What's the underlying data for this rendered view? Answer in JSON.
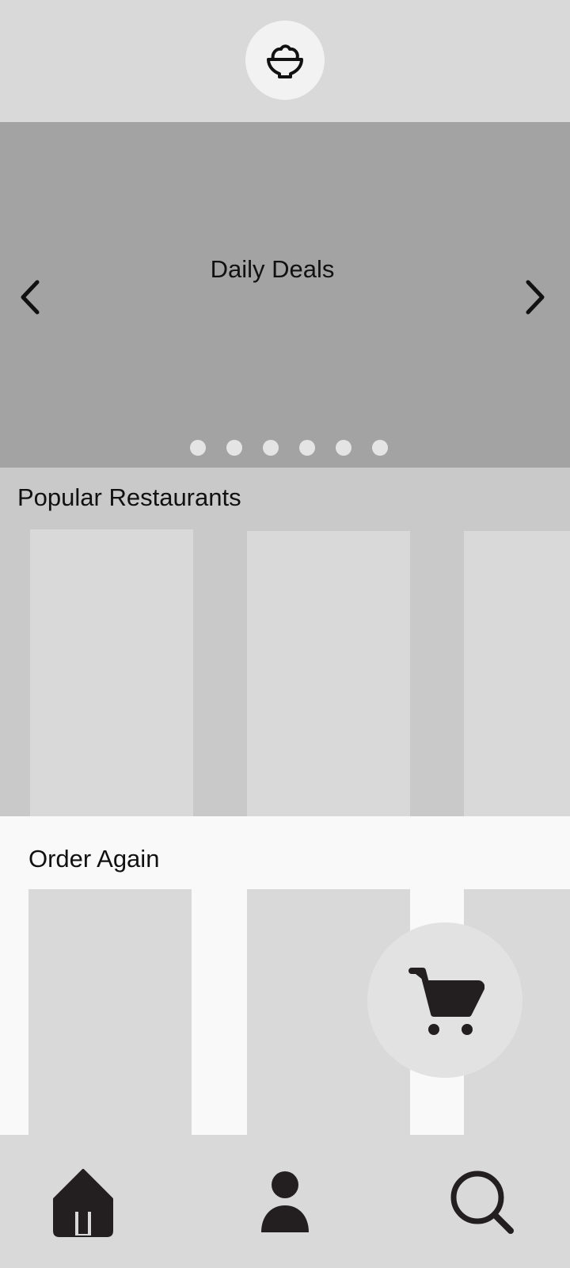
{
  "header": {
    "logo_icon": "rice-bowl-icon"
  },
  "carousel": {
    "title": "Daily Deals",
    "prev_icon": "chevron-left-icon",
    "next_icon": "chevron-right-icon",
    "page_count": 6,
    "active_page": null
  },
  "popular": {
    "title": "Popular Restaurants"
  },
  "order_again": {
    "title": "Order Again"
  },
  "cart": {
    "icon": "cart-icon"
  },
  "bottom_nav": {
    "items": [
      {
        "icon": "home-icon"
      },
      {
        "icon": "person-icon"
      },
      {
        "icon": "search-icon"
      }
    ]
  }
}
